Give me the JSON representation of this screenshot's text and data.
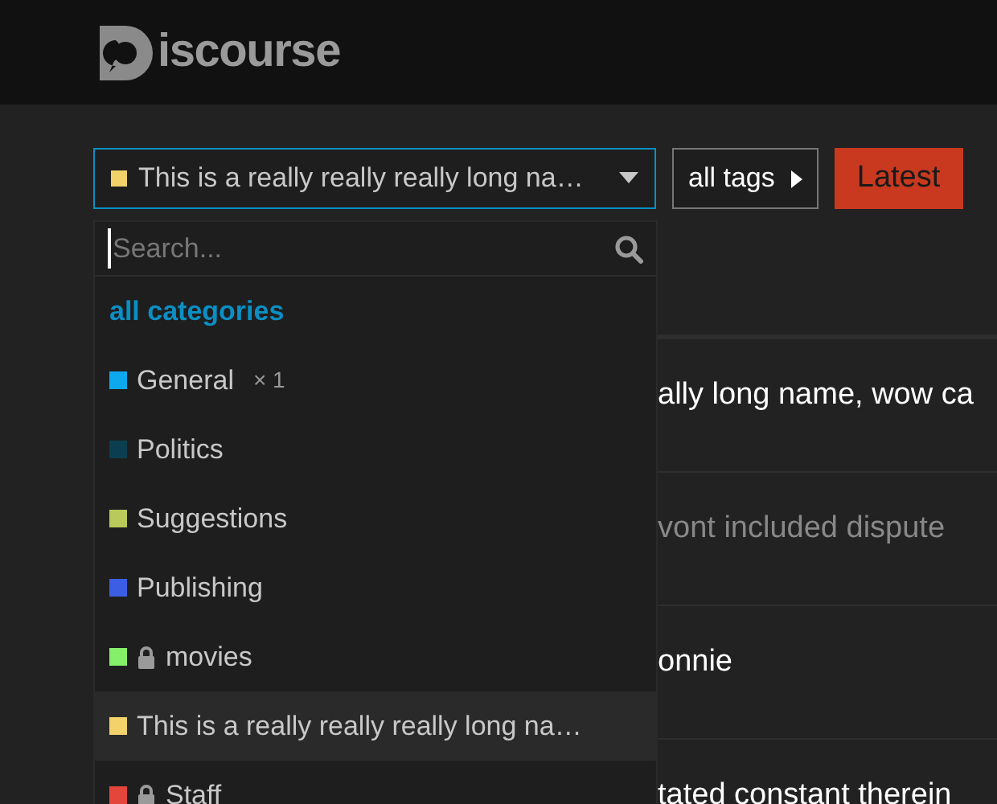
{
  "header": {
    "logo_text": "iscourse"
  },
  "filters": {
    "category_dropdown": {
      "label": "This is a really really really long na…",
      "color": "#f1d26b"
    },
    "tags_dropdown": {
      "label": "all tags"
    },
    "nav": [
      {
        "label": "Latest",
        "selected": true
      }
    ]
  },
  "category_menu": {
    "search": {
      "placeholder": "Search..."
    },
    "items": [
      {
        "kind": "all",
        "label": "all categories",
        "selected": false
      },
      {
        "kind": "category",
        "label": "General",
        "count": "× 1",
        "color": "#0ea8ee",
        "locked": false,
        "selected": false
      },
      {
        "kind": "category",
        "label": "Politics",
        "color": "#0b3f4f",
        "locked": false,
        "selected": false
      },
      {
        "kind": "category",
        "label": "Suggestions",
        "color": "#b9c95a",
        "locked": false,
        "selected": false
      },
      {
        "kind": "category",
        "label": "Publishing",
        "color": "#3b5ee5",
        "locked": false,
        "selected": false
      },
      {
        "kind": "category",
        "label": "movies",
        "color": "#86ef6a",
        "locked": true,
        "selected": false
      },
      {
        "kind": "category",
        "label": "This is a really really really long na…",
        "color": "#f1d26b",
        "locked": false,
        "selected": true
      },
      {
        "kind": "category",
        "label": "Staff",
        "color": "#e4463c",
        "locked": true,
        "selected": false
      }
    ]
  },
  "topics": [
    {
      "title": "ally long name, wow ca",
      "visited": false
    },
    {
      "title": "vont included dispute",
      "visited": true
    },
    {
      "title": "onnie",
      "visited": false
    },
    {
      "title": "tated constant therein",
      "visited": false
    }
  ]
}
